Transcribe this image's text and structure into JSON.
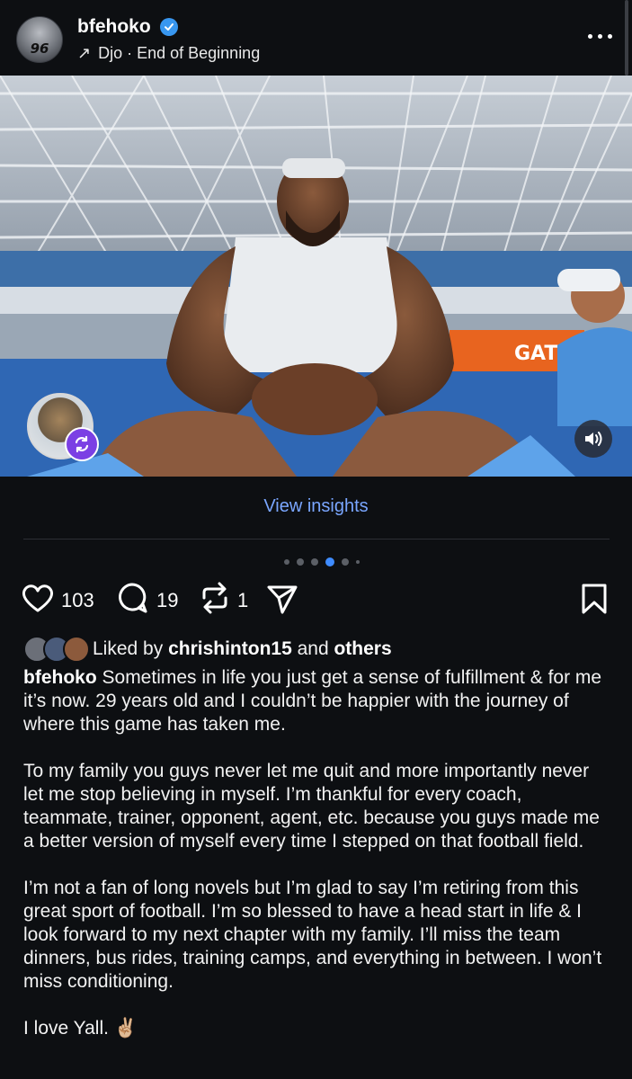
{
  "header": {
    "username": "bfehoko",
    "avatar_number": "96",
    "music_arrow": "↗",
    "music_text": "Djo · End of Beginning"
  },
  "media": {
    "banner_text": "GAT"
  },
  "insights_label": "View insights",
  "carousel": {
    "total": 6,
    "active_index": 3
  },
  "actions": {
    "likes": "103",
    "comments": "19",
    "reposts": "1"
  },
  "liked_by": {
    "prefix": "Liked by ",
    "user": "chrishinton15",
    "middle": " and ",
    "others": "others"
  },
  "caption": {
    "username": "bfehoko",
    "paragraph1": " Sometimes in life you just get a sense of fulfillment & for me it’s now. 29 years old and I couldn’t be happier with the journey of where this game has taken me.",
    "paragraph2": "To my family you guys never let me quit and more importantly never let me stop believing in myself. I’m thankful for every coach, teammate, trainer, opponent, agent, etc. because you guys made me a better version of myself every time I stepped on that football field.",
    "paragraph3": "I’m not a fan of long novels but I’m glad to say I’m retiring from this great sport of football. I’m so blessed to have a head start in life & I look forward to my next chapter with my family. I’ll miss the team dinners, bus rides, training camps, and everything in between. I won’t miss conditioning.",
    "paragraph4": "I love Yall. ✌🏼"
  },
  "colors": {
    "background": "#0d0f12",
    "link": "#7aa6ff",
    "verified": "#3897f0",
    "remix": "#7b3fe4",
    "carousel_active": "#3f8cff"
  }
}
